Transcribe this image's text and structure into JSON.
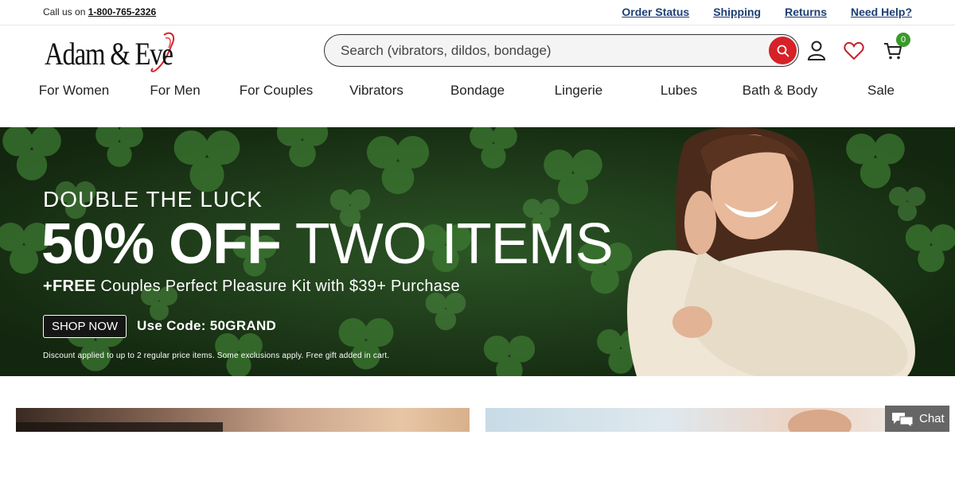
{
  "topbar": {
    "call_label": "Call us on",
    "phone": "1-800-765-2326",
    "links": [
      "Order Status",
      "Shipping",
      "Returns",
      "Need Help?"
    ]
  },
  "header": {
    "logo_text": "Adam & Eve",
    "search_placeholder": "Search (vibrators, dildos, bondage)",
    "cart_count": "0"
  },
  "nav": {
    "items": [
      "For Women",
      "For Men",
      "For Couples",
      "Vibrators",
      "Bondage",
      "Lingerie",
      "Lubes",
      "Bath & Body",
      "Sale"
    ]
  },
  "hero": {
    "kicker": "DOUBLE THE LUCK",
    "title_bold": "50% OFF",
    "title_light": "TWO ITEMS",
    "subtitle_bold": "+FREE",
    "subtitle_rest": "Couples Perfect Pleasure Kit with $39+ Purchase",
    "cta": "SHOP NOW",
    "code_text": "Use Code: 50GRAND",
    "disclaimer": "Discount applied to up to 2 regular price items. Some exclusions apply. Free gift added in cart."
  },
  "chat": {
    "label": "Chat"
  },
  "colors": {
    "brand_red": "#d62128",
    "link_blue": "#1d3f73",
    "badge_green": "#3a9a2a",
    "hero_green": "#1d3a1b"
  },
  "icons": [
    "search-icon",
    "account-icon",
    "heart-icon",
    "cart-icon",
    "chat-bubble-icon"
  ]
}
